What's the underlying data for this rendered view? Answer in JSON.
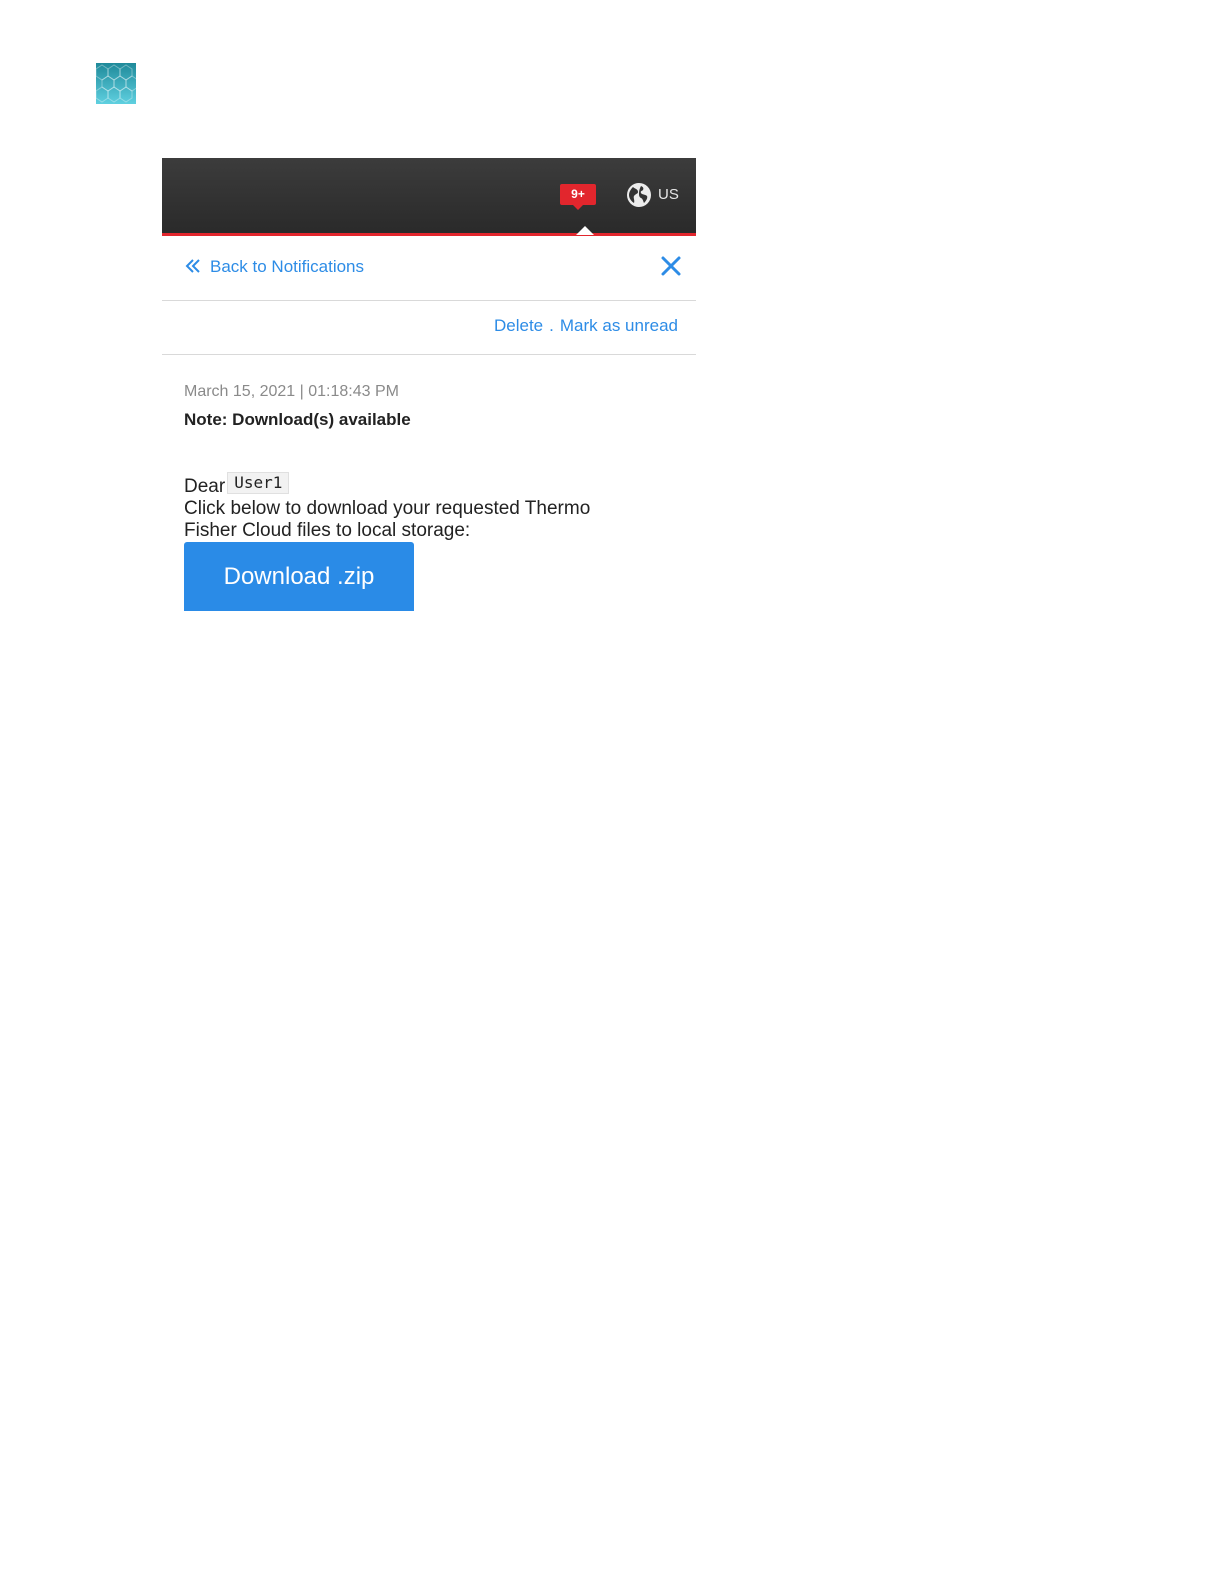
{
  "header": {
    "notification_badge": "9+",
    "locale": "US"
  },
  "back_row": {
    "back_label": "Back to Notifications"
  },
  "actions": {
    "delete_label": "Delete",
    "separator": ".",
    "mark_unread_label": "Mark as unread"
  },
  "message": {
    "date": "March 15, 2021 | 01:18:43 PM",
    "title": "Note: Download(s) available",
    "greeting": "Dear",
    "user": "User1",
    "line1": "Click below to download your requested Thermo",
    "line2": "Fisher Cloud files to local storage:",
    "download_label": "Download .zip"
  },
  "colors": {
    "accent_blue": "#2a8be7",
    "brand_red": "#e2262d",
    "header_dark": "#333333"
  },
  "icons": [
    "brand-logo-icon",
    "notification-icon",
    "globe-icon",
    "double-chevron-left-icon",
    "close-icon"
  ]
}
